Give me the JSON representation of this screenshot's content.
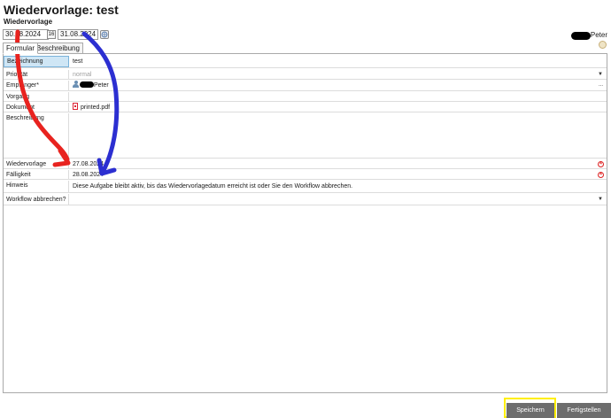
{
  "window": {
    "title": "Wiedervorlage: test",
    "subtitle": "Wiedervorlage"
  },
  "dates": {
    "start": "30.08.2024",
    "start_button_glyph": "16",
    "end": "31.08.2024"
  },
  "user": {
    "name": "Peter"
  },
  "tabs": [
    {
      "label": "Formular",
      "active": true
    },
    {
      "label": "Beschreibung",
      "active": false
    }
  ],
  "form": {
    "bezeichnung": {
      "label": "Bezeichnung",
      "value": "test"
    },
    "prioritaet": {
      "label": "Priorität",
      "value": "normal"
    },
    "empfaenger": {
      "label": "Empfänger*",
      "value": "Peter",
      "extra": "..."
    },
    "vorgang": {
      "label": "Vorgang",
      "value": ""
    },
    "dokument": {
      "label": "Dokument",
      "value": "printed.pdf"
    },
    "beschreibung": {
      "label": "Beschreibung",
      "value": ""
    },
    "wiedervorlage": {
      "label": "Wiedervorlage",
      "value": "27.08.2024"
    },
    "faelligkeit": {
      "label": "Fälligkeit",
      "value": "28.08.2024"
    },
    "hinweis": {
      "label": "Hinweis",
      "value": "Diese Aufgabe bleibt aktiv, bis das Wiedervorlagedatum erreicht ist oder Sie den Workflow abbrechen."
    },
    "workflow_abbrechen": {
      "label": "Workflow abbrechen?",
      "value": ""
    }
  },
  "buttons": {
    "save": "Speichern",
    "complete": "Fertigstellen"
  },
  "colors": {
    "red_annotation": "#e8231f",
    "blue_annotation": "#2c2fd1",
    "highlight": "#ffef00",
    "button_bg": "#6d6d6d",
    "selected_label": "#cfe6f5"
  },
  "icons": {
    "calendar_end": "calendar-icon",
    "settings": "settings-icon",
    "clear": "clear-icon",
    "pdf": "pdf-icon",
    "person": "person-icon"
  }
}
